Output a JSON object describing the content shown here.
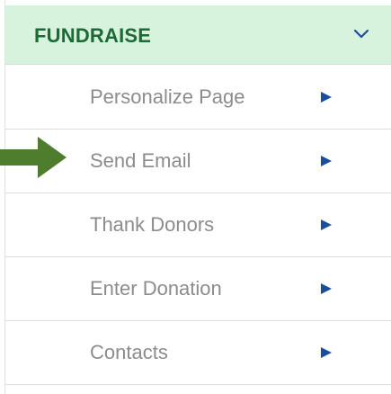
{
  "header": {
    "title": "FUNDRAISE",
    "chevron_icon": "chevron-down-icon"
  },
  "menu": {
    "items": [
      {
        "label": "Personalize Page",
        "icon": "play-arrow-icon"
      },
      {
        "label": "Send Email",
        "icon": "play-arrow-icon"
      },
      {
        "label": "Thank Donors",
        "icon": "play-arrow-icon"
      },
      {
        "label": "Enter Donation",
        "icon": "play-arrow-icon"
      },
      {
        "label": "Contacts",
        "icon": "play-arrow-icon"
      }
    ]
  },
  "annotation": {
    "icon": "green-pointer-arrow-icon",
    "points_to": "Send Email"
  },
  "colors": {
    "header_bg": "#d8f3dd",
    "header_text": "#1c6a35",
    "item_text": "#8c8c8c",
    "item_arrow": "#1a4fa0",
    "pointer_arrow": "#4e7d2e"
  }
}
